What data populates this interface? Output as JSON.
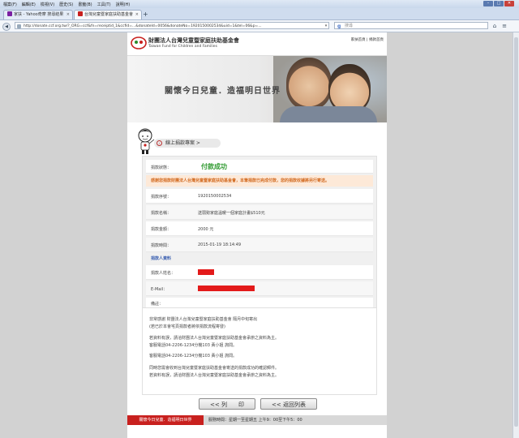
{
  "menu": [
    "檔案(F)",
    "編輯(E)",
    "檢視(V)",
    "歷史(S)",
    "書籤(B)",
    "工具(T)",
    "說明(H)"
  ],
  "tabs": [
    {
      "label": "家扶 - Yahoo奇摩 搜尋結果",
      "active": false
    },
    {
      "label": "台灣兒童暨家庭扶助基金會",
      "active": true
    }
  ],
  "toolbar": {
    "url": "http://donate.ccf.org.tw/?_ORG=ccf&fn=receiptid_1&ccfid=...&donateId=0056&donateNo=1920150002534&uid=1&tel=06&p=...",
    "search_placeholder": "搜尋"
  },
  "site": {
    "org_name": "財團法人台灣兒童暨家庭扶助基金會",
    "org_name_en": "Taiwan Fund for Children and Families",
    "toplinks": "家扶首頁 | 捐款首頁",
    "tagline": "關懷今日兒童．造福明日世界",
    "back_label": "線上捐款專案 >"
  },
  "donation": {
    "status_label": "捐款狀態：",
    "status_value": "付款成功",
    "notice": "感謝您捐款財團法人台灣兒童暨家庭扶助基金會，本筆捐款已完成付款，您的捐款收據將另行寄送。",
    "fields": [
      {
        "label": "捐款序號：",
        "value": "1920150002534"
      },
      {
        "label": "捐款名稱：",
        "value": "送弱勢家庭溫暖一個家庭計畫$510元"
      },
      {
        "label": "捐款金額：",
        "value": "2000 元"
      },
      {
        "label": "捐款時間：",
        "value": "2015-01-19 18:14:49"
      }
    ],
    "donor_section": "捐款人資料",
    "donor_fields": [
      {
        "label": "捐款人姓名："
      },
      {
        "label": "E-Mail："
      },
      {
        "label": "備註："
      }
    ]
  },
  "notes": [
    "非常感謝 財團法人台灣兒童暨家庭扶助基金會 隔月中旬寄出",
    "(若已於本會宅頁捐款者將依捐款流程寄發)",
    "若資料有誤，請洽財團法人台灣兒童暨家庭扶助基金會承辦之資料為主。",
    "客服電話04-2206-1234分機103 黃小姐 詢問。",
    "客服電話04-2206-1234分機103 黃小姐 詢問。",
    "同時您需會收到台灣兒童暨家庭扶助基金會寄送的捐款成功的確認郵件。",
    "若資料有誤，請洽財團法人台灣兒童暨家庭扶助基金會承辦之資料為主。"
  ],
  "buttons": {
    "print": "<< 列　　印",
    "back": "<< 返回列表"
  },
  "footer": {
    "tagline": "關懷今日兒童．造福明日世界",
    "service": "服務時間：星期一至星期五 上午9：00至下午5：00"
  },
  "colors": {
    "brand_red": "#c8201e",
    "success_green": "#2f9a2f",
    "notice_orange": "#d2691e",
    "section_blue": "#3a5fb0"
  }
}
